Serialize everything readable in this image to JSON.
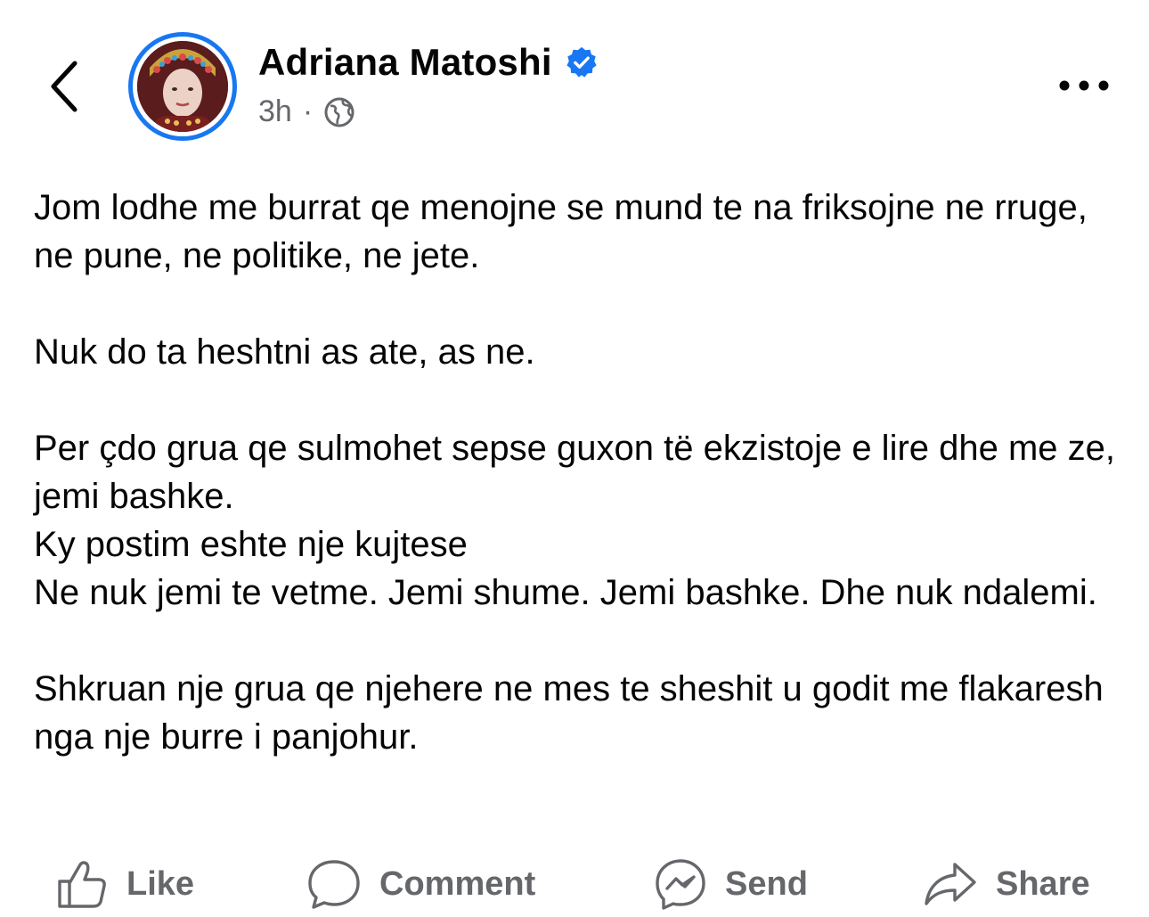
{
  "header": {
    "author_name": "Adriana Matoshi",
    "time_ago": "3h",
    "separator": "·",
    "verified_icon": "verified-badge-icon",
    "audience_icon": "globe-icon"
  },
  "post": {
    "paragraphs": [
      "Jom lodhe me burrat qe menojne se mund te na friksojne ne rruge, ne pune, ne politike, ne jete.",
      "Nuk do ta heshtni as ate, as ne.",
      "Per çdo grua qe sulmohet sepse guxon të ekzistoje e lire dhe me ze, jemi bashke.",
      "Ky postim eshte nje kujtese",
      "Ne nuk jemi te vetme. Jemi shume. Jemi bashke. Dhe nuk ndalemi.",
      "Shkruan nje grua qe njehere ne mes te sheshit u godit me flakaresh nga nje burre i panjohur."
    ]
  },
  "actions": {
    "like_label": "Like",
    "comment_label": "Comment",
    "send_label": "Send",
    "share_label": "Share"
  },
  "colors": {
    "accent": "#1877f2",
    "muted_text": "#65676b",
    "primary_text": "#050505"
  }
}
